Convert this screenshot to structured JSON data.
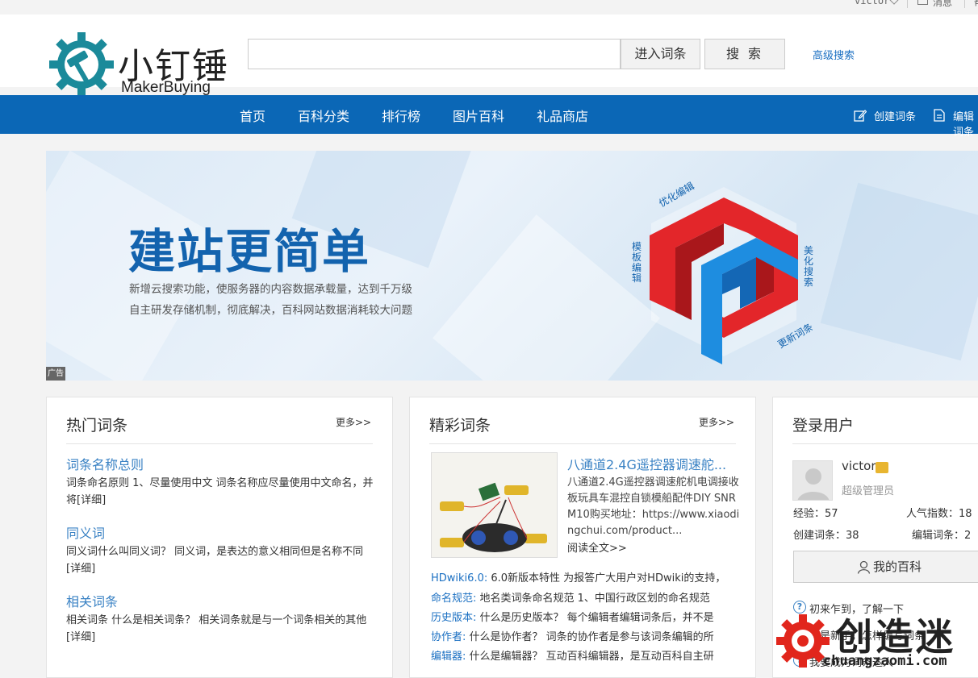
{
  "topbar": {
    "username": "victor",
    "messages_label": "消息",
    "more_label": "帮"
  },
  "header": {
    "logo_cn": "小钉锤",
    "logo_en": "MakerBuying",
    "search": {
      "value": "",
      "placeholder": ""
    },
    "enter_button": "进入词条",
    "search_button": "搜 索",
    "advanced_search": "高级搜索"
  },
  "nav": {
    "items": [
      "首页",
      "百科分类",
      "排行榜",
      "图片百科",
      "礼品商店"
    ],
    "create_entry": "创建词条",
    "edit_entry": "编辑词条"
  },
  "banner": {
    "title": "建站更简单",
    "line1": "新增云搜索功能，使服务器的内容数据承载量，达到千万级",
    "line2": "自主研发存储机制，彻底解决，百科网站数据消耗较大问题",
    "ad_tag": "广告",
    "cube_labels": {
      "top": "优化编辑",
      "left": "模板编辑",
      "right": "美化搜索",
      "bottom": "更新词条"
    }
  },
  "hot": {
    "title": "热门词条",
    "more": "更多>>",
    "items": [
      {
        "title": "词条名称总则",
        "text": "词条命名原则 1、尽量使用中文 词条名称应尽量使用中文命名，并将[详细]"
      },
      {
        "title": "同义词",
        "text": "同义词什么叫同义词？ 同义词，是表达的意义相同但是名称不同[详细]"
      },
      {
        "title": "相关词条",
        "text": "相关词条 什么是相关词条？ 相关词条就是与一个词条相关的其他[详细]"
      }
    ]
  },
  "featured": {
    "title": "精彩词条",
    "more": "更多>>",
    "main_title": "八通道2.4G遥控器调速舵...",
    "main_text": "八通道2.4G遥控器调速舵机电调接收板玩具车混控自锁模船配件DIY SNRM10购买地址：https://www.xiaodingchui.com/product...",
    "read_more": "阅读全文>>",
    "rows": [
      {
        "key": "HDwiki6.0:",
        "text": " 6.0新版本特性 为报答广大用户对HDwiki的支持，"
      },
      {
        "key": "命名规范:",
        "text": " 地名类词条命名规范 1、中国行政区划的命名规范"
      },
      {
        "key": "历史版本:",
        "text": " 什么是历史版本？ 每个编辑者编辑词条后，并不是"
      },
      {
        "key": "协作者:",
        "text": " 什么是协作者？ 词条的协作者是参与该词条编辑的所"
      },
      {
        "key": "编辑器:",
        "text": " 什么是编辑器？ 互动百科编辑器，是互动百科自主研"
      }
    ]
  },
  "login": {
    "title": "登录用户",
    "username": "victor",
    "role": "超级管理员",
    "exp": "经验：57",
    "popularity": "人气指数：18",
    "created": "创建词条：38",
    "edited": "编辑词条：2",
    "my_wiki": "我的百科",
    "links": [
      "初来乍到，了解一下",
      "我是新手，怎样编写词条",
      "我要成为词条达人"
    ]
  },
  "watermark": {
    "cn": "创造迷",
    "en": "chuangzaomi.com"
  },
  "colors": {
    "nav": "#0b67b6",
    "link": "#3a82c4",
    "brand_teal": "#1b8a9a",
    "cube_red": "#e3262a",
    "cube_blue": "#1e8de0"
  }
}
